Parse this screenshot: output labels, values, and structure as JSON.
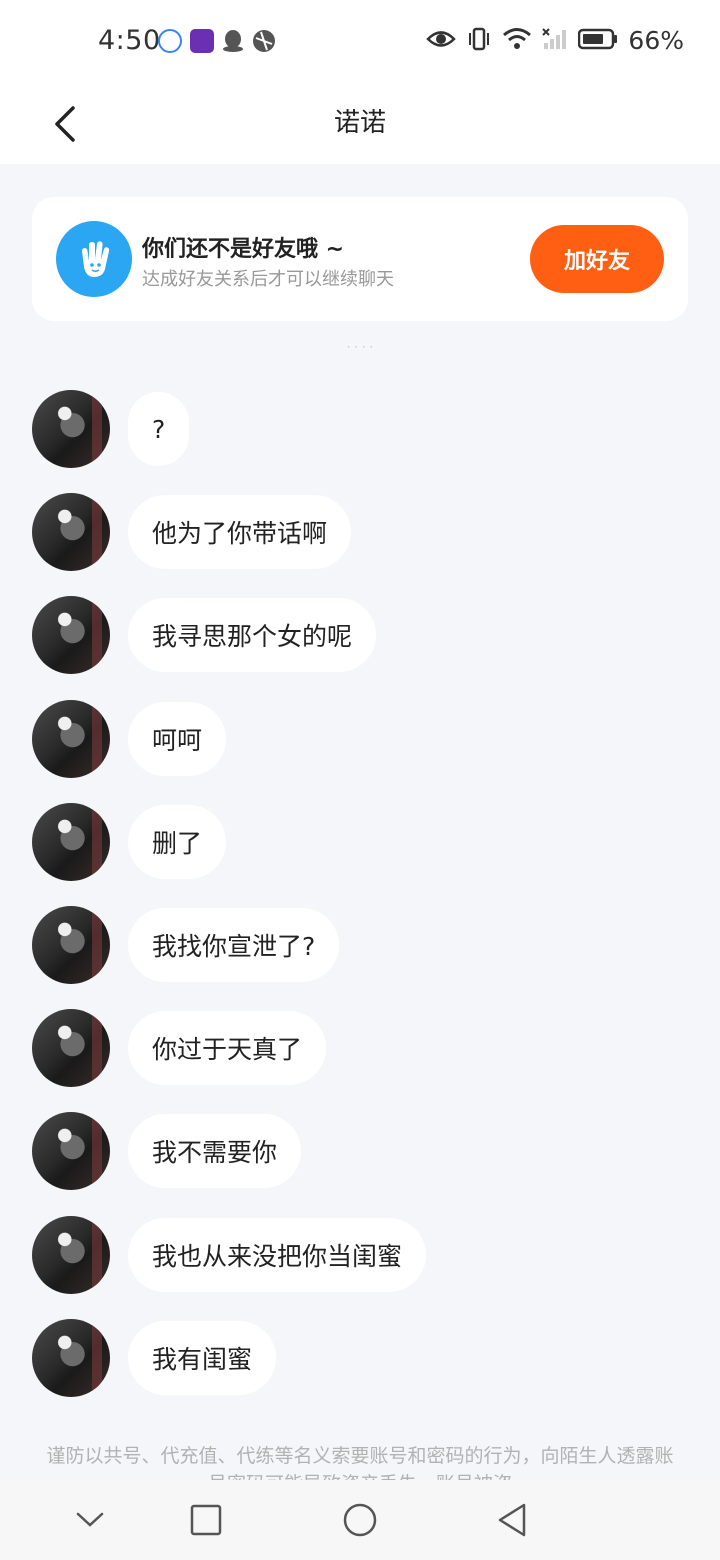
{
  "status_bar": {
    "time": "4:50",
    "battery": "66%",
    "icons": [
      "music-app-icon",
      "game-app-icon",
      "qq-penguin-icon",
      "browser-icon",
      "eye-icon",
      "vibrate-icon",
      "wifi-icon",
      "signal-icon",
      "battery-icon"
    ]
  },
  "header": {
    "title": "诺诺",
    "back_icon": "chevron-left-icon"
  },
  "friend_card": {
    "title": "你们还不是好友哦 ~",
    "subtitle": "达成好友关系后才可以继续聊天",
    "button_label": "加好友",
    "icon": "hand-wave-icon",
    "accent_color": "#ff5f13",
    "icon_color": "#2aa6f2"
  },
  "faded_text": "· · · ·",
  "messages": [
    {
      "text": "?"
    },
    {
      "text": "他为了你带话啊"
    },
    {
      "text": "我寻思那个女的呢"
    },
    {
      "text": "呵呵"
    },
    {
      "text": "删了"
    },
    {
      "text": "我找你宣泄了?"
    },
    {
      "text": "你过于天真了"
    },
    {
      "text": "我不需要你"
    },
    {
      "text": "我也从来没把你当闺蜜"
    },
    {
      "text": "我有闺蜜"
    }
  ],
  "warning": "谨防以共号、代充值、代练等名义索要账号和密码的行为，向陌生人透露账号密码可能导致资产丢失、账号被盗",
  "nav_bar": {
    "icons": [
      "chevron-down-icon",
      "square-icon",
      "circle-icon",
      "triangle-back-icon"
    ]
  }
}
